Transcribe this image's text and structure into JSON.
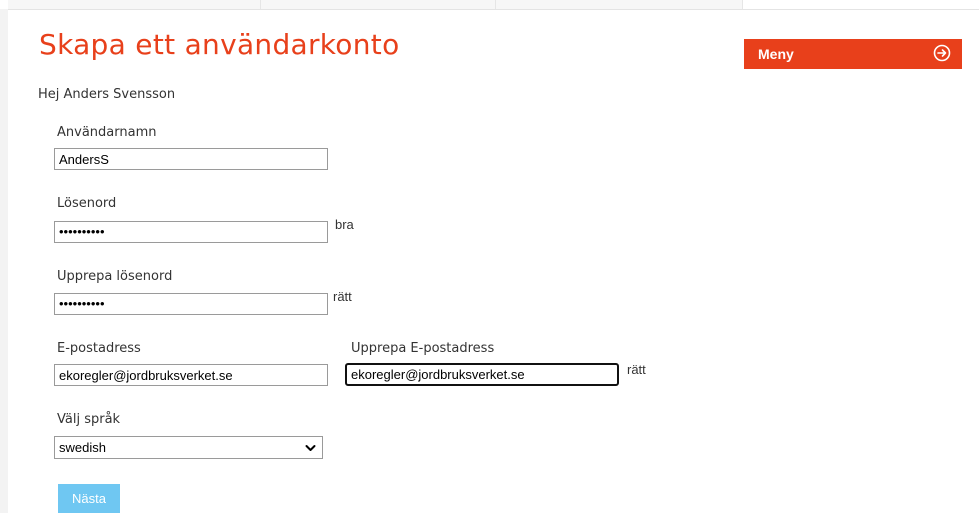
{
  "page": {
    "title": "Skapa ett användarkonto",
    "greeting": "Hej Anders Svensson"
  },
  "menu": {
    "label": "Meny",
    "icon": "arrow-right-circle-icon",
    "color": "#e8401b"
  },
  "form": {
    "username": {
      "label": "Användarnamn",
      "value": "AndersS"
    },
    "password": {
      "label": "Lösenord",
      "masked_value": "••••••••••",
      "status": "bra"
    },
    "password_repeat": {
      "label": "Upprepa lösenord",
      "masked_value": "••••••••••",
      "status": "rätt"
    },
    "email": {
      "label": "E-postadress",
      "value": "ekoregler@jordbruksverket.se"
    },
    "email_repeat": {
      "label": "Upprepa E-postadress",
      "value": "ekoregler@jordbruksverket.se",
      "status": "rätt"
    },
    "language": {
      "label": "Välj språk",
      "selected": "swedish"
    },
    "next_label": "Nästa"
  },
  "colors": {
    "accent": "#e8401b",
    "next_button": "#6fc7f2"
  }
}
